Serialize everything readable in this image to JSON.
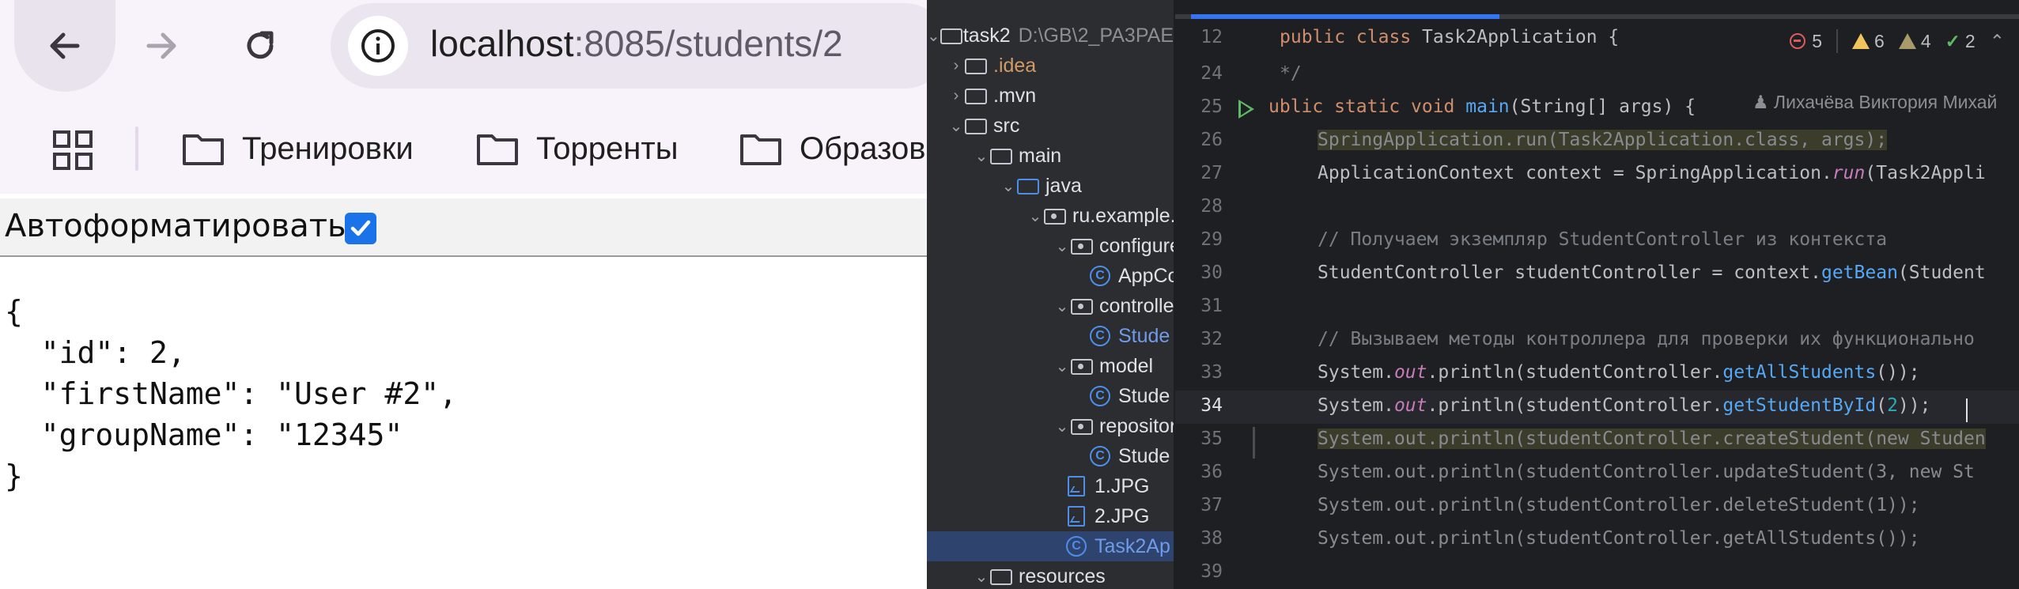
{
  "browser": {
    "url_host": "localhost",
    "url_path": ":8085/students/2",
    "bookmarks": [
      {
        "label": "Тренировки"
      },
      {
        "label": "Торренты"
      },
      {
        "label": "Образов"
      }
    ],
    "autoformat_label": "Автоформатировать",
    "autoformat_checked": true,
    "json_lines": [
      "{",
      "  \"id\": 2,",
      "  \"firstName\": \"User #2\",",
      "  \"groupName\": \"12345\"",
      "}"
    ]
  },
  "ide": {
    "project": {
      "root_name": "task2",
      "root_path": "D:\\GB\\2_PA3PAE",
      "items": [
        {
          "label": ".idea"
        },
        {
          "label": ".mvn"
        },
        {
          "label": "src"
        },
        {
          "label": "main"
        },
        {
          "label": "java"
        },
        {
          "label": "ru.example.t"
        },
        {
          "label": "configure"
        },
        {
          "label": "AppCo"
        },
        {
          "label": "controller"
        },
        {
          "label": "Stude"
        },
        {
          "label": "model"
        },
        {
          "label": "Stude"
        },
        {
          "label": "repositor"
        },
        {
          "label": "Stude"
        },
        {
          "label": "1.JPG"
        },
        {
          "label": "2.JPG"
        },
        {
          "label": "Task2Ap"
        },
        {
          "label": "resources"
        }
      ]
    },
    "inspections": {
      "errors": "5",
      "warnings": "6",
      "weak_warnings": "4",
      "typos": "2"
    },
    "author_hint": "Лихачёва Виктория Михай",
    "code": [
      {
        "ln": "12",
        "text": "public class Task2Application {"
      },
      {
        "ln": "24",
        "text": "*/"
      },
      {
        "ln": "25",
        "text": "public static void main(String[] args) {"
      },
      {
        "ln": "26",
        "text": "SpringApplication.run(Task2Application.class, args);"
      },
      {
        "ln": "27",
        "text": "ApplicationContext context = SpringApplication.run(Task2Appli"
      },
      {
        "ln": "28",
        "text": ""
      },
      {
        "ln": "29",
        "text": "// Получаем экземпляр StudentController из контекста"
      },
      {
        "ln": "30",
        "text": "StudentController studentController = context.getBean(Student"
      },
      {
        "ln": "31",
        "text": ""
      },
      {
        "ln": "32",
        "text": "// Вызываем методы контроллера для проверки их функционально"
      },
      {
        "ln": "33",
        "text": "System.out.println(studentController.getAllStudents());"
      },
      {
        "ln": "34",
        "text": "System.out.println(studentController.getStudentById(2));"
      },
      {
        "ln": "35",
        "text": "System.out.println(studentController.createStudent(new Studen"
      },
      {
        "ln": "36",
        "text": "System.out.println(studentController.updateStudent(3, new St"
      },
      {
        "ln": "37",
        "text": "System.out.println(studentController.deleteStudent(1));"
      },
      {
        "ln": "38",
        "text": "System.out.println(studentController.getAllStudents());"
      },
      {
        "ln": "39",
        "text": ""
      }
    ]
  }
}
